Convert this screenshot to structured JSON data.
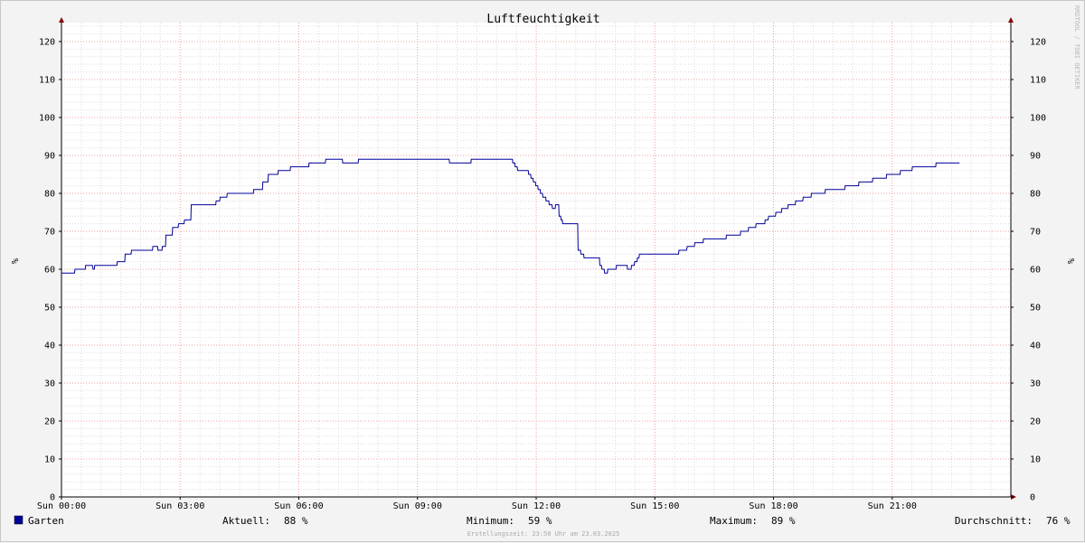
{
  "chart_data": {
    "type": "line",
    "title": "Luftfeuchtigkeit",
    "ylabel": "%",
    "ylabel_right": "%",
    "ylim": [
      0,
      125
    ],
    "yticks": [
      0,
      10,
      20,
      30,
      40,
      50,
      60,
      70,
      80,
      90,
      100,
      110,
      120
    ],
    "xticks": [
      "Sun 00:00",
      "Sun 03:00",
      "Sun 06:00",
      "Sun 09:00",
      "Sun 12:00",
      "Sun 15:00",
      "Sun 18:00",
      "Sun 21:00"
    ],
    "xlim_hours": [
      0,
      24
    ],
    "grid": true,
    "legend_position": "bottom-left",
    "series": [
      {
        "name": "Garten",
        "color": "#000099",
        "x_hours": [
          0.0,
          0.33,
          0.34,
          0.6,
          0.61,
          0.78,
          0.8,
          0.83,
          0.84,
          1.4,
          1.41,
          1.6,
          1.61,
          1.76,
          1.77,
          2.3,
          2.31,
          2.43,
          2.44,
          2.54,
          2.55,
          2.63,
          2.64,
          2.8,
          2.81,
          2.95,
          2.96,
          3.1,
          3.11,
          3.27,
          3.28,
          3.9,
          3.91,
          4.0,
          4.01,
          4.18,
          4.19,
          4.85,
          4.86,
          5.08,
          5.09,
          5.22,
          5.23,
          5.47,
          5.48,
          5.78,
          5.79,
          6.25,
          6.26,
          6.67,
          6.68,
          7.1,
          7.11,
          7.5,
          7.51,
          9.8,
          9.81,
          10.35,
          10.36,
          11.4,
          11.41,
          11.46,
          11.47,
          11.52,
          11.53,
          11.8,
          11.81,
          11.86,
          11.87,
          11.92,
          11.93,
          11.98,
          11.99,
          12.04,
          12.05,
          12.1,
          12.11,
          12.16,
          12.17,
          12.24,
          12.25,
          12.32,
          12.33,
          12.4,
          12.41,
          12.48,
          12.49,
          12.57,
          12.58,
          12.62,
          12.63,
          12.66,
          12.67,
          13.05,
          13.06,
          13.12,
          13.13,
          13.2,
          13.21,
          13.6,
          13.61,
          13.65,
          13.66,
          13.72,
          13.73,
          13.8,
          13.81,
          14.02,
          14.03,
          14.3,
          14.31,
          14.4,
          14.41,
          14.48,
          14.49,
          14.55,
          14.56,
          14.6,
          14.61,
          15.6,
          15.61,
          15.8,
          15.82,
          16.0,
          16.01,
          16.22,
          16.23,
          16.8,
          16.81,
          17.16,
          17.17,
          17.36,
          17.37,
          17.55,
          17.56,
          17.78,
          17.79,
          17.86,
          17.88,
          18.05,
          18.06,
          18.2,
          18.21,
          18.36,
          18.37,
          18.55,
          18.56,
          18.74,
          18.75,
          18.95,
          18.96,
          19.3,
          19.31,
          19.8,
          19.81,
          20.15,
          20.16,
          20.5,
          20.51,
          20.85,
          20.86,
          21.2,
          21.21,
          21.5,
          21.51,
          22.1,
          22.11,
          22.7,
          22.71,
          22.9,
          22.91,
          23.0,
          23.01,
          23.22,
          23.23,
          23.5,
          23.51,
          23.88,
          23.89,
          24.0
        ],
        "values": [
          59,
          59,
          60,
          60,
          61,
          61,
          60,
          60,
          61,
          61,
          62,
          62,
          64,
          64,
          65,
          65,
          66,
          66,
          65,
          65,
          66,
          66,
          69,
          69,
          71,
          71,
          72,
          72,
          73,
          73,
          77,
          77,
          78,
          78,
          79,
          79,
          80,
          80,
          81,
          81,
          83,
          83,
          85,
          85,
          86,
          86,
          87,
          87,
          88,
          88,
          89,
          89,
          88,
          88,
          89,
          89,
          88,
          88,
          89,
          89,
          88,
          88,
          87,
          87,
          86,
          86,
          85,
          85,
          84,
          84,
          83,
          83,
          82,
          82,
          81,
          81,
          80,
          80,
          79,
          79,
          78,
          78,
          77,
          77,
          76,
          76,
          77,
          77,
          74,
          74,
          73,
          73,
          72,
          72,
          65,
          65,
          64,
          64,
          63,
          63,
          61,
          61,
          60,
          60,
          59,
          59,
          60,
          60,
          61,
          61,
          60,
          60,
          61,
          61,
          62,
          62,
          63,
          63,
          64,
          64,
          65,
          65,
          66,
          66,
          67,
          67,
          68,
          68,
          69,
          69,
          70,
          70,
          71,
          71,
          72,
          72,
          73,
          73,
          74,
          74,
          75,
          75,
          76,
          76,
          77,
          77,
          78,
          78,
          79,
          79,
          80,
          80,
          81,
          81,
          82,
          82,
          83,
          83,
          84,
          84,
          85,
          85,
          86,
          86,
          87,
          87,
          88,
          88
        ]
      }
    ],
    "legend": {
      "series_name": "Garten",
      "stats": [
        {
          "label": "Aktuell:",
          "value": "88 %"
        },
        {
          "label": "Minimum:",
          "value": "59 %"
        },
        {
          "label": "Maximum:",
          "value": "89 %"
        },
        {
          "label": "Durchschnitt:",
          "value": "76 %"
        }
      ]
    },
    "footer": "Erstellungszeit: 23:58 Uhr am 23.03.2025",
    "watermark": "RRDTOOL / TOBI OETIKER"
  }
}
